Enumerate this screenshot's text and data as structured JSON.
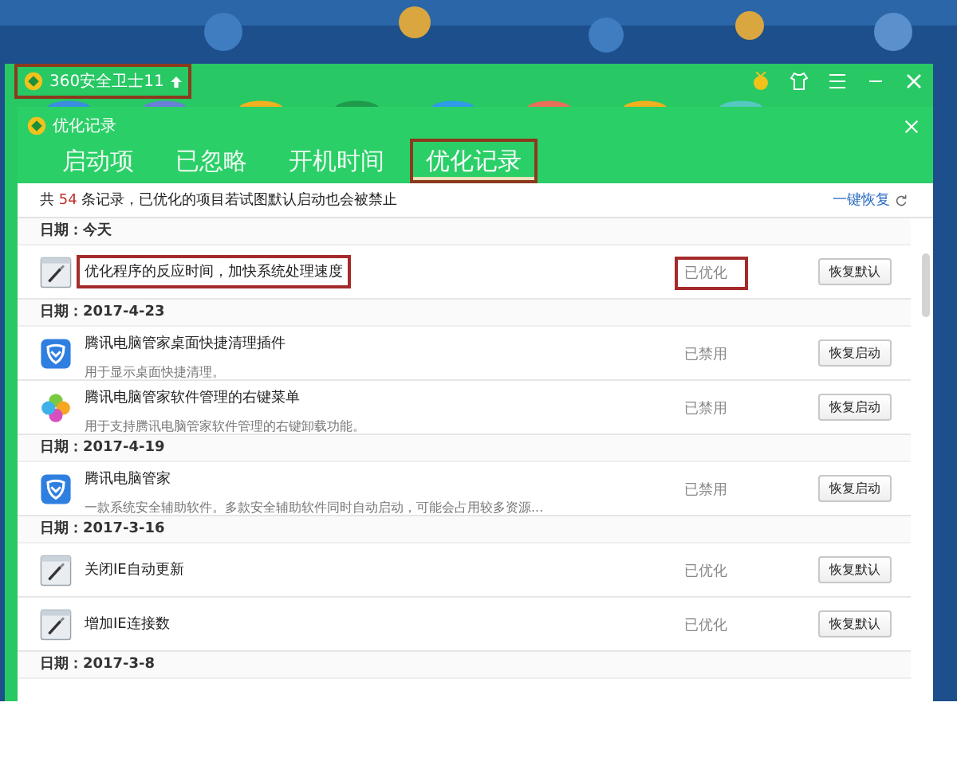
{
  "main_window": {
    "title": "360安全卫士11",
    "highlighted": true
  },
  "dialog": {
    "title": "优化记录",
    "tabs": [
      {
        "label": "启动项",
        "selected": false,
        "highlighted": false
      },
      {
        "label": "已忽略",
        "selected": false,
        "highlighted": false
      },
      {
        "label": "开机时间",
        "selected": false,
        "highlighted": false
      },
      {
        "label": "优化记录",
        "selected": true,
        "highlighted": true
      }
    ],
    "summary": {
      "prefix": "共",
      "count": "54",
      "suffix": "条记录，已优化的项目若试图默认启动也会被禁止"
    },
    "restore_all_link": "一键恢复",
    "groups": [
      {
        "date": "日期：今天",
        "items": [
          {
            "kind": "tweak",
            "title": "优化程序的反应时间，加快系统处理速度",
            "status": "已优化",
            "button": "恢复默认",
            "highlighted": true
          }
        ]
      },
      {
        "date": "日期：2017-4-23",
        "items": [
          {
            "kind": "shield",
            "title": "腾讯电脑管家桌面快捷清理插件",
            "description": "用于显示桌面快捷清理。",
            "status": "已禁用",
            "button": "恢复启动",
            "highlighted": false
          },
          {
            "kind": "clover",
            "title": "腾讯电脑管家软件管理的右键菜单",
            "description": "用于支持腾讯电脑管家软件管理的右键卸载功能。",
            "status": "已禁用",
            "button": "恢复启动",
            "highlighted": false
          }
        ]
      },
      {
        "date": "日期：2017-4-19",
        "items": [
          {
            "kind": "shield",
            "title": "腾讯电脑管家",
            "description": "一款系统安全辅助软件。多款安全辅助软件同时自动启动，可能会占用较多资源...",
            "status": "已禁用",
            "button": "恢复启动",
            "highlighted": false
          }
        ]
      },
      {
        "date": "日期：2017-3-16",
        "items": [
          {
            "kind": "tweak",
            "title": "关闭IE自动更新",
            "status": "已优化",
            "button": "恢复默认",
            "highlighted": false
          },
          {
            "kind": "tweak",
            "title": "增加IE连接数",
            "status": "已优化",
            "button": "恢复默认",
            "highlighted": false
          }
        ]
      },
      {
        "date": "日期：2017-3-8"
      }
    ]
  }
}
